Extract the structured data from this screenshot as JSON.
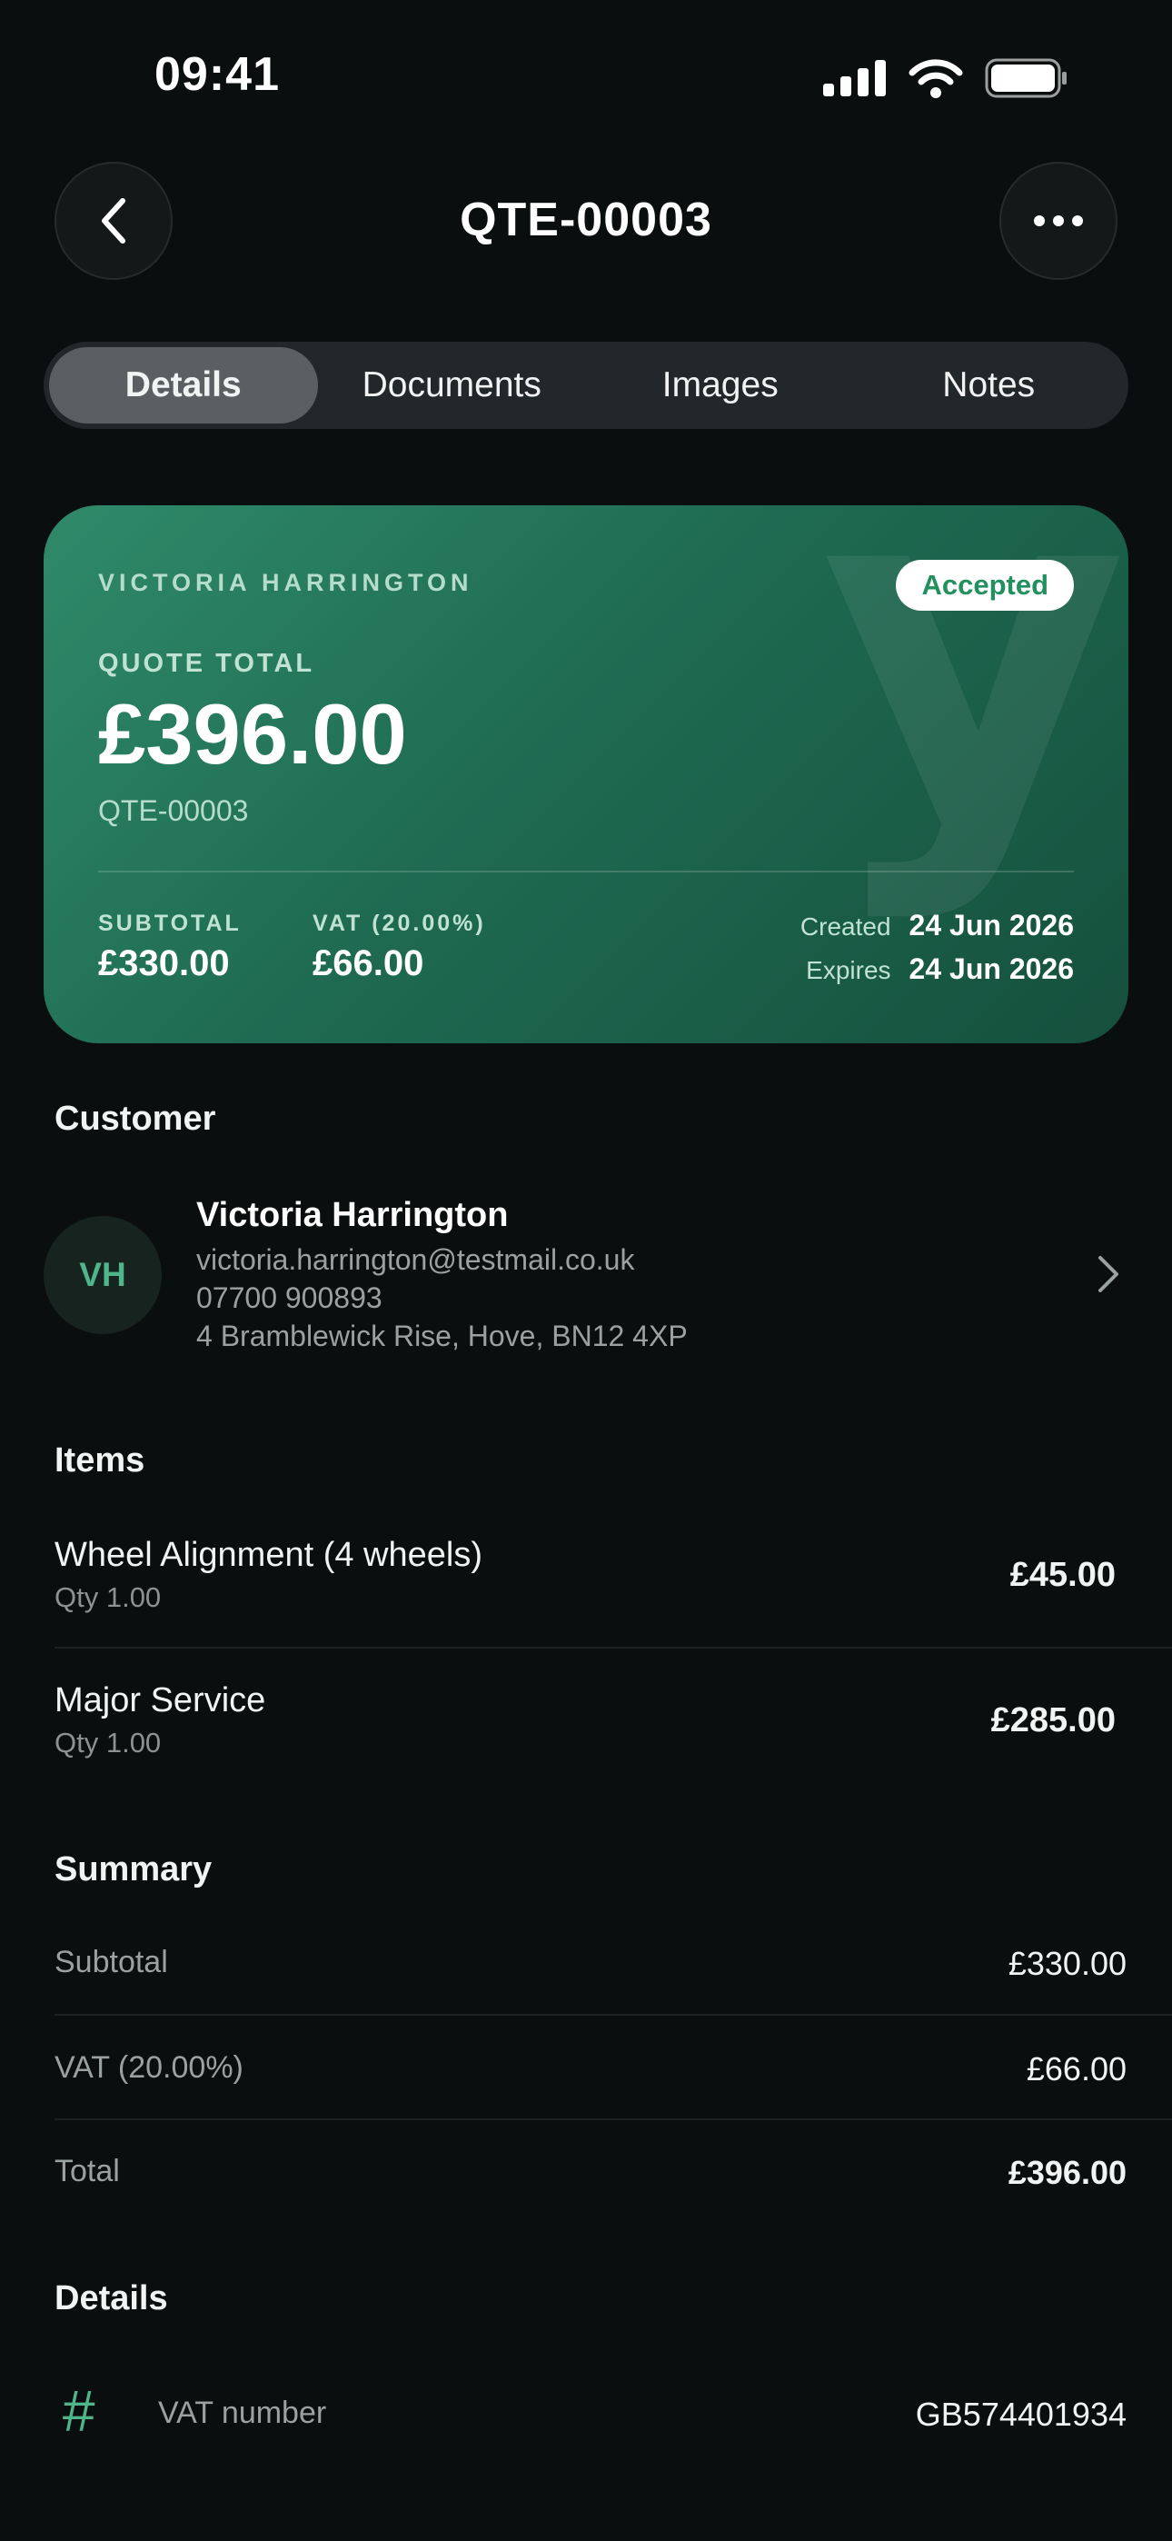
{
  "status_bar": {
    "time": "09:41"
  },
  "header": {
    "title": "QTE-00003"
  },
  "tabs": [
    {
      "label": "Details",
      "active": true
    },
    {
      "label": "Documents",
      "active": false
    },
    {
      "label": "Images",
      "active": false
    },
    {
      "label": "Notes",
      "active": false
    }
  ],
  "hero": {
    "customer": "VICTORIA HARRINGTON",
    "status": "Accepted",
    "total_label": "QUOTE TOTAL",
    "total": "£396.00",
    "reference": "QTE-00003",
    "subtotal_label": "SUBTOTAL",
    "subtotal": "£330.00",
    "vat_label": "VAT (20.00%)",
    "vat": "£66.00",
    "created_label": "Created",
    "created": "24 Jun 2026",
    "expires_label": "Expires",
    "expires": "24 Jun 2026",
    "watermark": "y"
  },
  "customer_section": {
    "title": "Customer",
    "initials": "VH",
    "name": "Victoria Harrington",
    "email": "victoria.harrington@testmail.co.uk",
    "phone": "07700 900893",
    "address": "4 Bramblewick Rise, Hove, BN12 4XP"
  },
  "items_section": {
    "title": "Items",
    "items": [
      {
        "name": "Wheel Alignment (4 wheels)",
        "qty": "Qty 1.00",
        "price": "£45.00"
      },
      {
        "name": "Major Service",
        "qty": "Qty 1.00",
        "price": "£285.00"
      }
    ]
  },
  "summary_section": {
    "title": "Summary",
    "rows": [
      {
        "label": "Subtotal",
        "value": "£330.00"
      },
      {
        "label": "VAT (20.00%)",
        "value": "£66.00"
      },
      {
        "label": "Total",
        "value": "£396.00"
      }
    ]
  },
  "details_section": {
    "title": "Details",
    "icon_glyph": "#",
    "vat_label": "VAT number",
    "vat_value": "GB574401934"
  },
  "colors": {
    "background": "#0b0e0e",
    "accent_green": "#4fb58a",
    "card_gradient_start": "#2f8a6a",
    "card_gradient_end": "#15503d",
    "badge_text": "#22905f"
  }
}
